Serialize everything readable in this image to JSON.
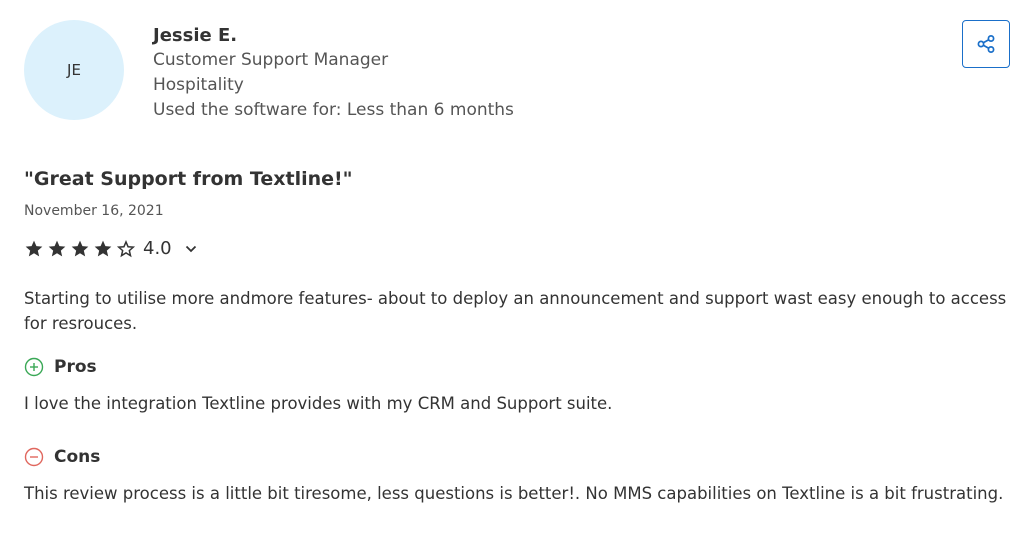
{
  "reviewer": {
    "initials": "JE",
    "name": "Jessie E.",
    "role": "Customer Support Manager",
    "industry": "Hospitality",
    "usage": "Used the software for: Less than 6 months"
  },
  "share": {
    "icon": "share-icon"
  },
  "review": {
    "title": "\"Great Support from Textline!\"",
    "date": "November 16, 2021",
    "rating": 4.0,
    "rating_text": "4.0",
    "max_rating": 5,
    "summary": "Starting to utilise more andmore features- about to deploy an announcement and support wast easy enough to access for resrouces.",
    "pros_label": "Pros",
    "pros_text": "I love the integration Textline provides with my CRM and Support suite.",
    "cons_label": "Cons",
    "cons_text": "This review process is a little bit tiresome, less questions is better!. No MMS capabilities on Textline is a bit frustrating."
  },
  "colors": {
    "avatar_bg": "#dcf1fc",
    "accent": "#1a6fc9",
    "pros": "#3aa856",
    "cons": "#e0675e",
    "star": "#333333"
  }
}
